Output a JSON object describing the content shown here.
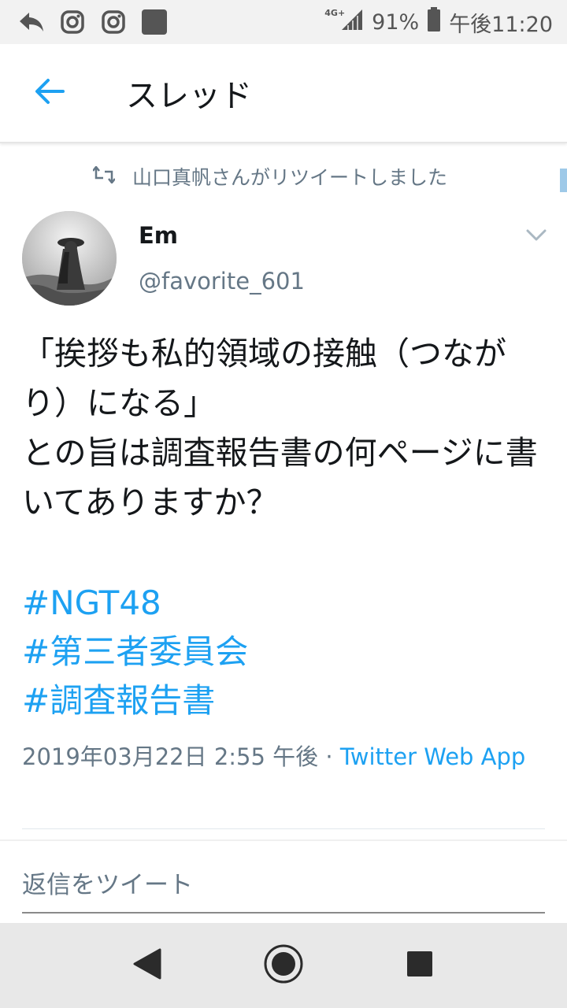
{
  "status_bar": {
    "network": "4G+",
    "battery_percent": "91%",
    "time": "午後11:20",
    "left_icons": [
      "reply-arrow-icon",
      "instagram-icon",
      "instagram-icon",
      "notification-square-icon"
    ]
  },
  "header": {
    "title": "スレッド",
    "back_icon": "back-arrow-icon"
  },
  "retweet": {
    "icon": "retweet-icon",
    "text": "山口真帆さんがリツイートしました"
  },
  "tweet": {
    "display_name": "Em",
    "handle": "@favorite_601",
    "text": "「挨拶も私的領域の接触（つながり）になる」\nとの旨は調査報告書の何ページに書いてありますか？",
    "hashtags": [
      "#NGT48",
      "#第三者委員会",
      "#調査報告書"
    ],
    "timestamp": "2019年03月22日 2:55 午後 · ",
    "source": "Twitter Web App"
  },
  "reply": {
    "placeholder": "返信をツイート"
  },
  "colors": {
    "accent": "#1da1f2",
    "secondary_text": "#657786",
    "primary_text": "#14171a"
  }
}
